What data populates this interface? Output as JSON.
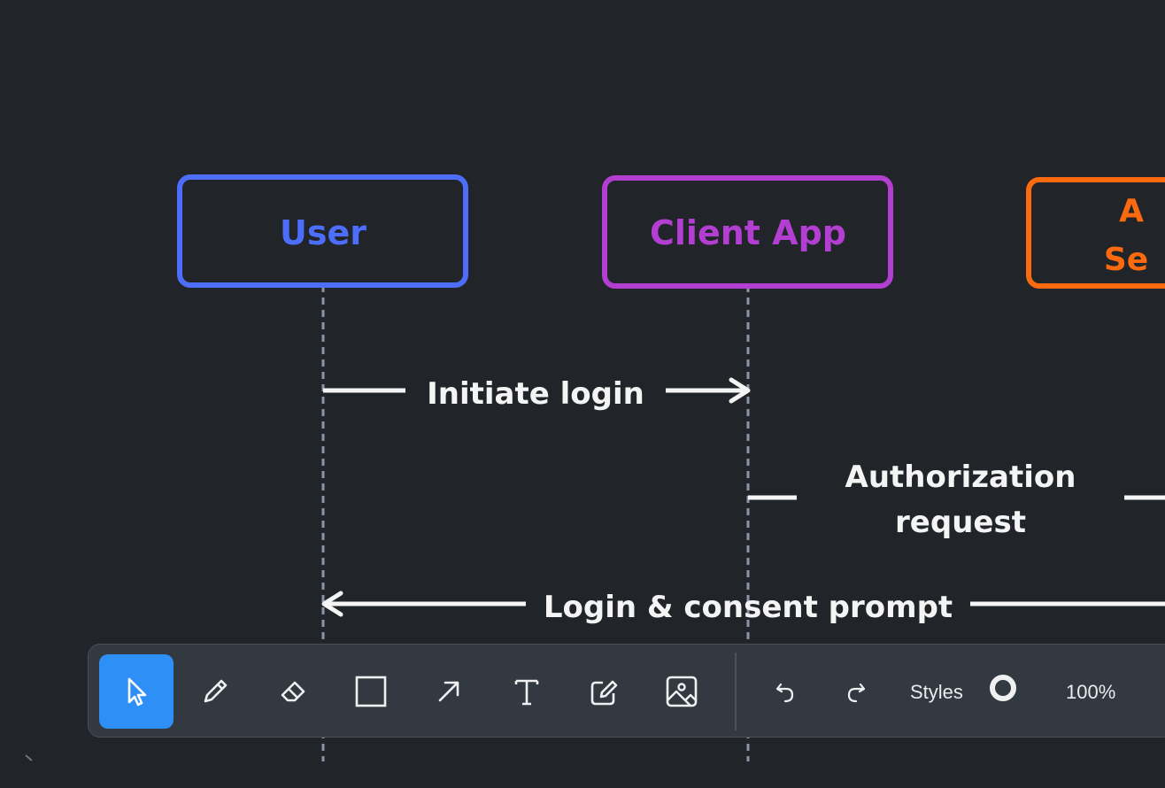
{
  "diagram": {
    "participants": [
      {
        "label": "User",
        "color": "#4d6dfb"
      },
      {
        "label": "Client App",
        "color": "#b23fd1"
      },
      {
        "label_lines": [
          "A",
          "Se"
        ],
        "color": "#fb6a0e"
      }
    ],
    "messages": [
      {
        "label": "Initiate login"
      },
      {
        "label_lines": [
          "Authorization",
          "request"
        ]
      },
      {
        "label": "Login & consent prompt"
      }
    ]
  },
  "toolbar": {
    "tools": [
      {
        "name": "select",
        "icon": "cursor-icon",
        "active": true
      },
      {
        "name": "draw",
        "icon": "pencil-icon"
      },
      {
        "name": "eraser",
        "icon": "eraser-icon"
      },
      {
        "name": "rectangle",
        "icon": "rectangle-icon"
      },
      {
        "name": "arrow",
        "icon": "arrow-icon"
      },
      {
        "name": "text",
        "icon": "text-icon"
      },
      {
        "name": "note",
        "icon": "note-icon"
      },
      {
        "name": "image",
        "icon": "image-icon"
      }
    ],
    "undo_icon": "undo-icon",
    "redo_icon": "redo-icon",
    "styles_label": "Styles",
    "zoom_label": "100%"
  },
  "colors": {
    "background": "#212428",
    "toolbar": "#333940",
    "accent": "#2e8ff6",
    "lifeline": "#8c93a8",
    "arrow": "#f4f4f4"
  }
}
